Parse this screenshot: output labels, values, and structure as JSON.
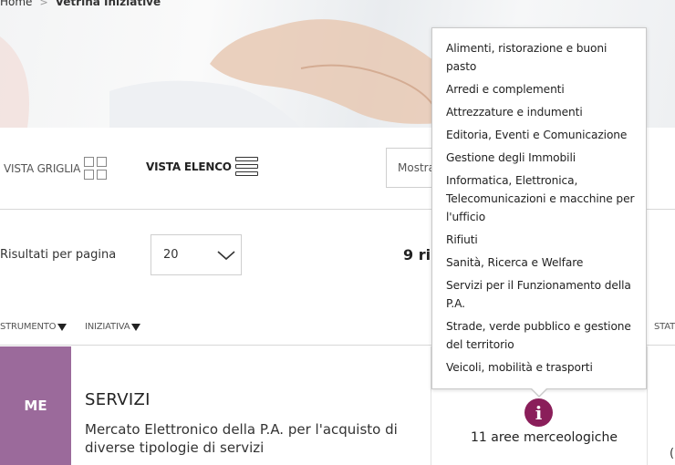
{
  "breadcrumb": {
    "home": "Home",
    "separator": ">",
    "current": "Vetrina Iniziative"
  },
  "view": {
    "grid_label": "VISTA GRIGLIA",
    "list_label": "VISTA ELENCO",
    "mostra": "Mostra"
  },
  "pagination": {
    "per_page_label": "Risultati per pagina",
    "per_page_value": "20",
    "results_count": "9 ris"
  },
  "table": {
    "headers": {
      "strumento": "STRUMENTO",
      "iniziativa": "INIZIATIVA",
      "stato": "STAT"
    }
  },
  "row": {
    "badge": "ME",
    "badge_color": "#9b6a9b",
    "title": "SERVIZI",
    "description": "Mercato Elettronico della P.A. per l'acquisto di diverse tipologie di servizi",
    "aree_label": "11 aree merceologiche",
    "info_icon_color": "#8a1e5a",
    "cut_text": "("
  },
  "popover": {
    "items": [
      "Alimenti, ristorazione e buoni pasto",
      "Arredi e complementi",
      "Attrezzature e indumenti",
      "Editoria, Eventi e Comunicazione",
      "Gestione degli Immobili",
      "Informatica, Elettronica, Telecomunicazioni e macchine per l'ufficio",
      "Rifiuti",
      "Sanità, Ricerca e Welfare",
      "Servizi per il Funzionamento della P.A.",
      "Strade, verde pubblico e gestione del territorio",
      "Veicoli, mobilità e trasporti"
    ]
  }
}
